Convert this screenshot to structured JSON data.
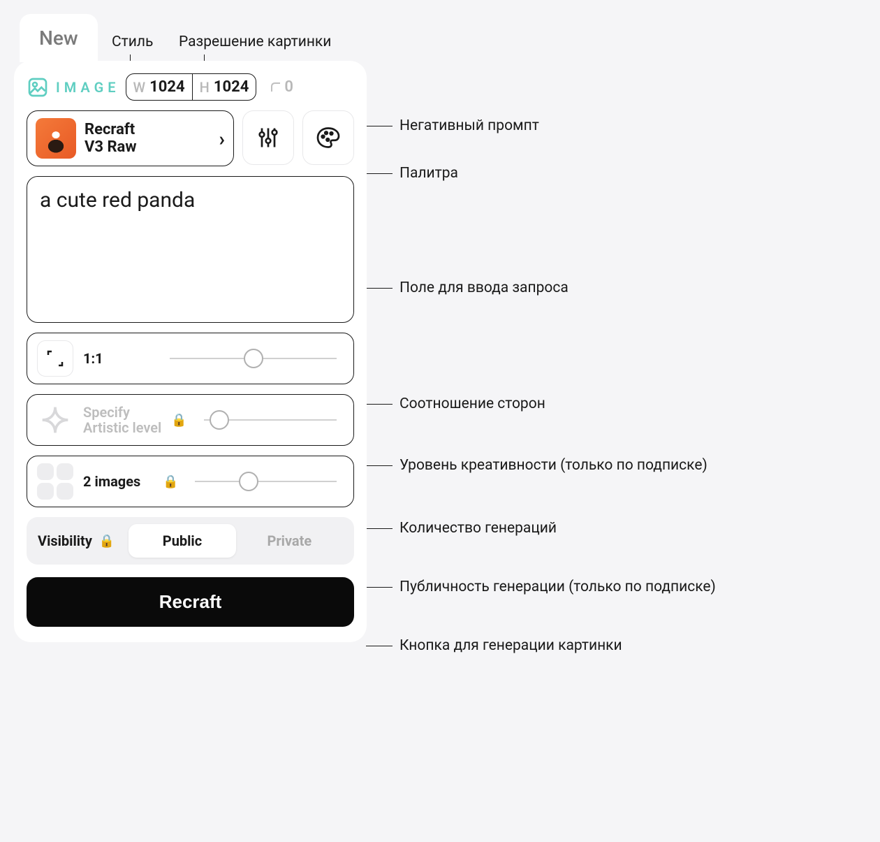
{
  "tab": {
    "label": "New"
  },
  "header": {
    "mode_label": "IMAGE",
    "width_label": "W",
    "width_value": "1024",
    "height_label": "H",
    "height_value": "1024",
    "corner_value": "0"
  },
  "style_selector": {
    "name": "Recraft\nV3 Raw"
  },
  "prompt": {
    "text": "a cute red panda"
  },
  "aspect_ratio": {
    "label": "1:1"
  },
  "artistic_level": {
    "label_line1": "Specify",
    "label_line2": "Artistic level"
  },
  "image_count": {
    "label": "2 images"
  },
  "visibility": {
    "label": "Visibility",
    "option_public": "Public",
    "option_private": "Private"
  },
  "generate": {
    "label": "Recraft"
  },
  "annotations": {
    "style": "Стиль",
    "resolution": "Разрешение картинки",
    "negative_prompt": "Негативный промпт",
    "palette": "Палитра",
    "prompt_field": "Поле для ввода запроса",
    "aspect_ratio": "Соотношение сторон",
    "creativity": "Уровень креативности (только по подписке)",
    "generation_count": "Количество генераций",
    "visibility_note": "Публичность генерации (только по подписке)",
    "generate_btn": "Кнопка для генерации картинки"
  }
}
